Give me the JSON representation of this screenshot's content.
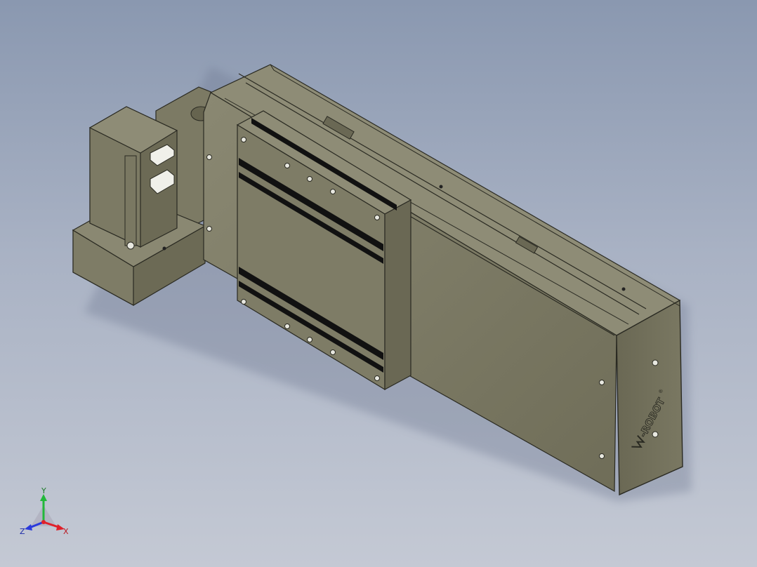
{
  "model": {
    "brand_mark": "-ROBOT",
    "registered_mark": "®"
  },
  "triad": {
    "x_label": "X",
    "y_label": "Y",
    "z_label": "Z",
    "x_color": "#e0202a",
    "y_color": "#22b83a",
    "z_color": "#2a3adc"
  },
  "colors": {
    "body": "#7e7c66",
    "body_dark": "#5e5c4a",
    "body_light": "#8c8a72",
    "edge": "#2a2a22",
    "slot": "#111111"
  }
}
